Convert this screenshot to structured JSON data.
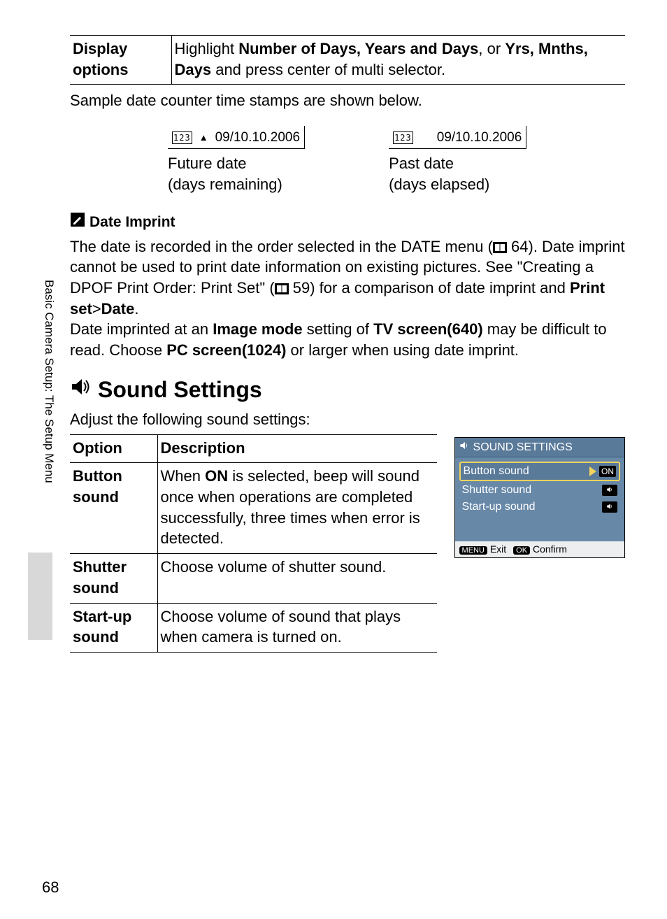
{
  "sidebar_label": "Basic Camera Setup: The Setup Menu",
  "page_number": "68",
  "display_options": {
    "label": "Display options",
    "text_parts": [
      "Highlight ",
      "Number of Days, Years and Days",
      ", or ",
      "Yrs, Mnths, Days",
      " and press center of multi selector."
    ]
  },
  "sample_intro": "Sample date counter time stamps are shown below.",
  "sample_future": {
    "icon": "123",
    "symbol": "▲",
    "date": "09/10.10.2006",
    "line1": "Future date",
    "line2": "(days remaining)"
  },
  "sample_past": {
    "icon": "123",
    "date": "09/10.10.2006",
    "line1": "Past date",
    "line2": "(days elapsed)"
  },
  "note": {
    "title": "Date Imprint",
    "p1_a": "The date is recorded in the order selected in the DATE menu (",
    "p1_b": " 64). Date imprint cannot be used to print date information on existing pictures. See \"Creating a DPOF Print Order: Print Set\" (",
    "p1_c": " 59) for a comparison of date imprint and ",
    "p1_d": "Print set",
    "p1_e": ">",
    "p1_f": "Date",
    "p1_g": ".",
    "p2_a": "Date imprinted at an ",
    "p2_b": "Image mode",
    "p2_c": " setting of ",
    "p2_d": "TV screen(640)",
    "p2_e": " may be difficult to read. Choose ",
    "p2_f": "PC screen(1024)",
    "p2_g": " or larger when using date imprint."
  },
  "sound": {
    "heading": "Sound Settings",
    "intro": "Adjust the following sound settings:",
    "th_option": "Option",
    "th_desc": "Description",
    "rows": [
      {
        "opt": "Button sound",
        "desc_a": "When ",
        "desc_b": "ON",
        "desc_c": " is selected, beep will sound once when operations are completed successfully, three times when error is detected."
      },
      {
        "opt": "Shutter sound",
        "desc": "Choose volume of shutter sound."
      },
      {
        "opt": "Start-up sound",
        "desc": "Choose volume of sound that plays when camera is turned on."
      }
    ]
  },
  "screen": {
    "title": "SOUND SETTINGS",
    "items": [
      {
        "label": "Button sound",
        "badge": "ON",
        "selected": true
      },
      {
        "label": "Shutter sound",
        "badge": "🔊",
        "selected": false
      },
      {
        "label": "Start-up sound",
        "badge": "🔊",
        "selected": false
      }
    ],
    "footer_menu": "MENU",
    "footer_exit": "Exit",
    "footer_ok": "OK",
    "footer_confirm": "Confirm"
  }
}
